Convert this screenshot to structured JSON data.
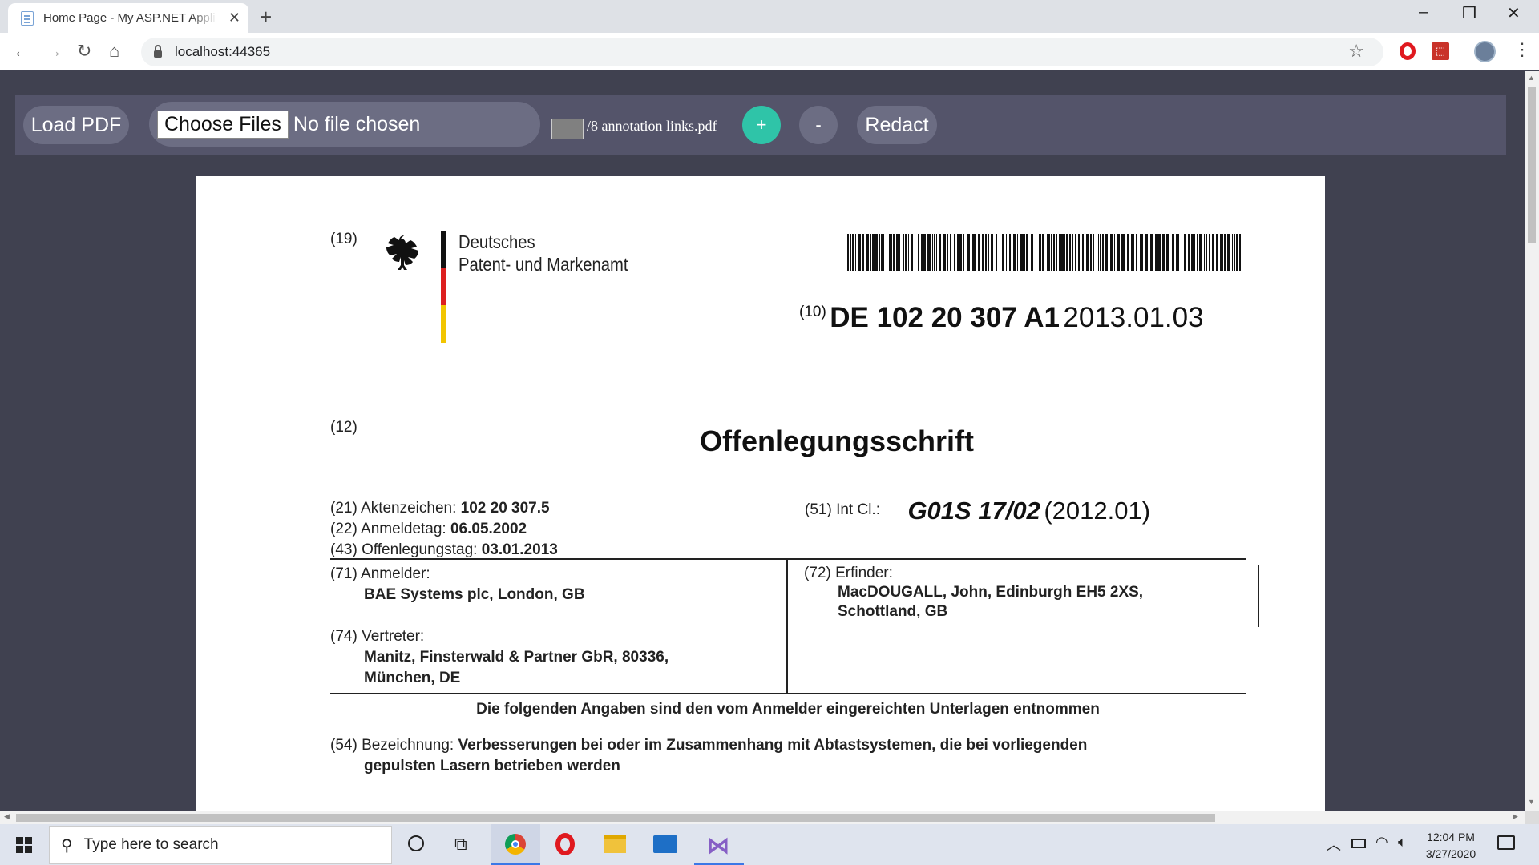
{
  "browser": {
    "tab_title": "Home Page - My ASP.NET Application",
    "new_tab": "+",
    "url": "localhost:44365",
    "window": {
      "minimize": "–",
      "restore": "❐",
      "close": "✕"
    }
  },
  "toolbar": {
    "load_pdf": "Load PDF",
    "choose_files": "Choose Files",
    "no_file": "No file chosen",
    "page_value": "",
    "page_label": "/8 annotation links.pdf",
    "zoom_in": "+",
    "zoom_out": "-",
    "redact": "Redact",
    "zoom_in_color": "#2fc4a8",
    "button_color": "#6c6d83"
  },
  "document": {
    "n19": "(19)",
    "agency_line1": "Deutsches",
    "agency_line2": "Patent- und Markenamt",
    "n10": "(10)",
    "doc_number": "DE 102 20 307 A1",
    "doc_date": "2013.01.03",
    "n12": "(12)",
    "doc_type": "Offenlegungsschrift",
    "f21_label": "(21) Aktenzeichen:",
    "f21_value": "102 20 307.5",
    "f22_label": "(22) Anmeldetag:",
    "f22_value": "06.05.2002",
    "f43_label": "(43) Offenlegungstag:",
    "f43_value": "03.01.2013",
    "f51_label": "(51) Int Cl.:",
    "f51_value": "G01S 17/02",
    "f51_year": "(2012.01)",
    "f71_label": "(71) Anmelder:",
    "f71_value": "BAE Systems plc, London, GB",
    "f72_label": "(72) Erfinder:",
    "f72_value_1": "MacDOUGALL, John, Edinburgh EH5 2XS,",
    "f72_value_2": "Schottland, GB",
    "f74_label": "(74) Vertreter:",
    "f74_value_1": "Manitz, Finsterwald & Partner GbR, 80336,",
    "f74_value_2": "München, DE",
    "notice": "Die folgenden Angaben sind den vom Anmelder eingereichten Unterlagen entnommen",
    "f54_label": "(54) Bezeichnung:",
    "f54_value_1": "Verbesserungen bei oder im Zusammenhang mit Abtastsystemen, die bei vorliegenden",
    "f54_value_2": "gepulsten Lasern betrieben werden",
    "flag_colors": [
      "#111111",
      "#dd1f1f",
      "#f2c500"
    ]
  },
  "taskbar": {
    "search_placeholder": "Type here to search",
    "time": "12:04 PM",
    "date": "3/27/2020"
  }
}
